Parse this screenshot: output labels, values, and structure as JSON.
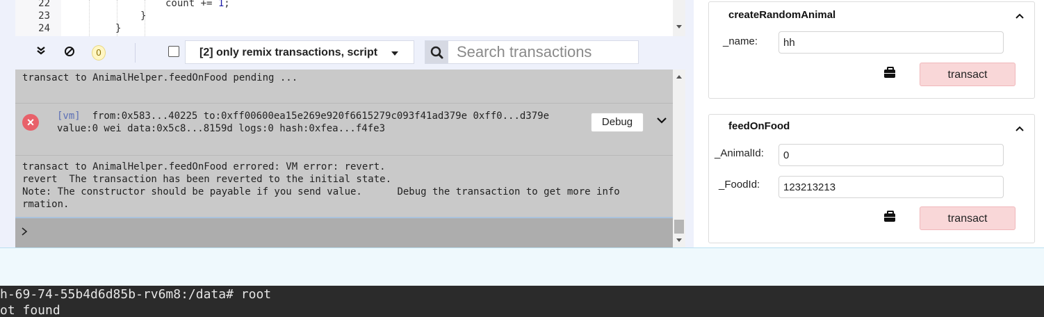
{
  "editor": {
    "lines": [
      {
        "number": "22",
        "code": "count += ",
        "num": "1",
        "end": ";"
      },
      {
        "number": "23",
        "code": "}"
      },
      {
        "number": "24",
        "code": "}"
      }
    ]
  },
  "terminal": {
    "pending_count": "0",
    "filter_label": "[2] only remix transactions, script",
    "search_placeholder": "Search transactions",
    "pending_message": "transact to AnimalHelper.feedOnFood pending ...",
    "tx": {
      "tag": "[vm]",
      "line1": "from:0x583...40225 to:0xff00600ea15e269e920f6615279c093f41ad379e 0xff0...d379e",
      "line2": "value:0 wei data:0x5c8...8159d logs:0 hash:0xfea...f4fe3",
      "debug_label": "Debug"
    },
    "error_lines": [
      "transact to AnimalHelper.feedOnFood errored: VM error: revert.",
      "revert  The transaction has been reverted to the initial state.",
      "Note: The constructor should be payable if you send value.      Debug the transaction to get more info",
      "rmation."
    ],
    "prompt_symbol": ">"
  },
  "functions": [
    {
      "name": "createRandomAnimal",
      "params": [
        {
          "label": "_name:",
          "value": "hh"
        }
      ],
      "button": "transact"
    },
    {
      "name": "feedOnFood",
      "params": [
        {
          "label": "_AnimalId:",
          "value": "0"
        },
        {
          "label": "_FoodId:",
          "value": "123213213"
        }
      ],
      "button": "transact"
    }
  ],
  "shell": {
    "lines": [
      "h-69-74-55b4d6d85b-rv6m8:/data# root",
      "ot found"
    ]
  },
  "colors": {
    "transact_bg": "#f9d7d8",
    "error_icon": "#e8616a",
    "log_bg": "#c9c9c9",
    "shell_bg": "#2b2b2b"
  }
}
